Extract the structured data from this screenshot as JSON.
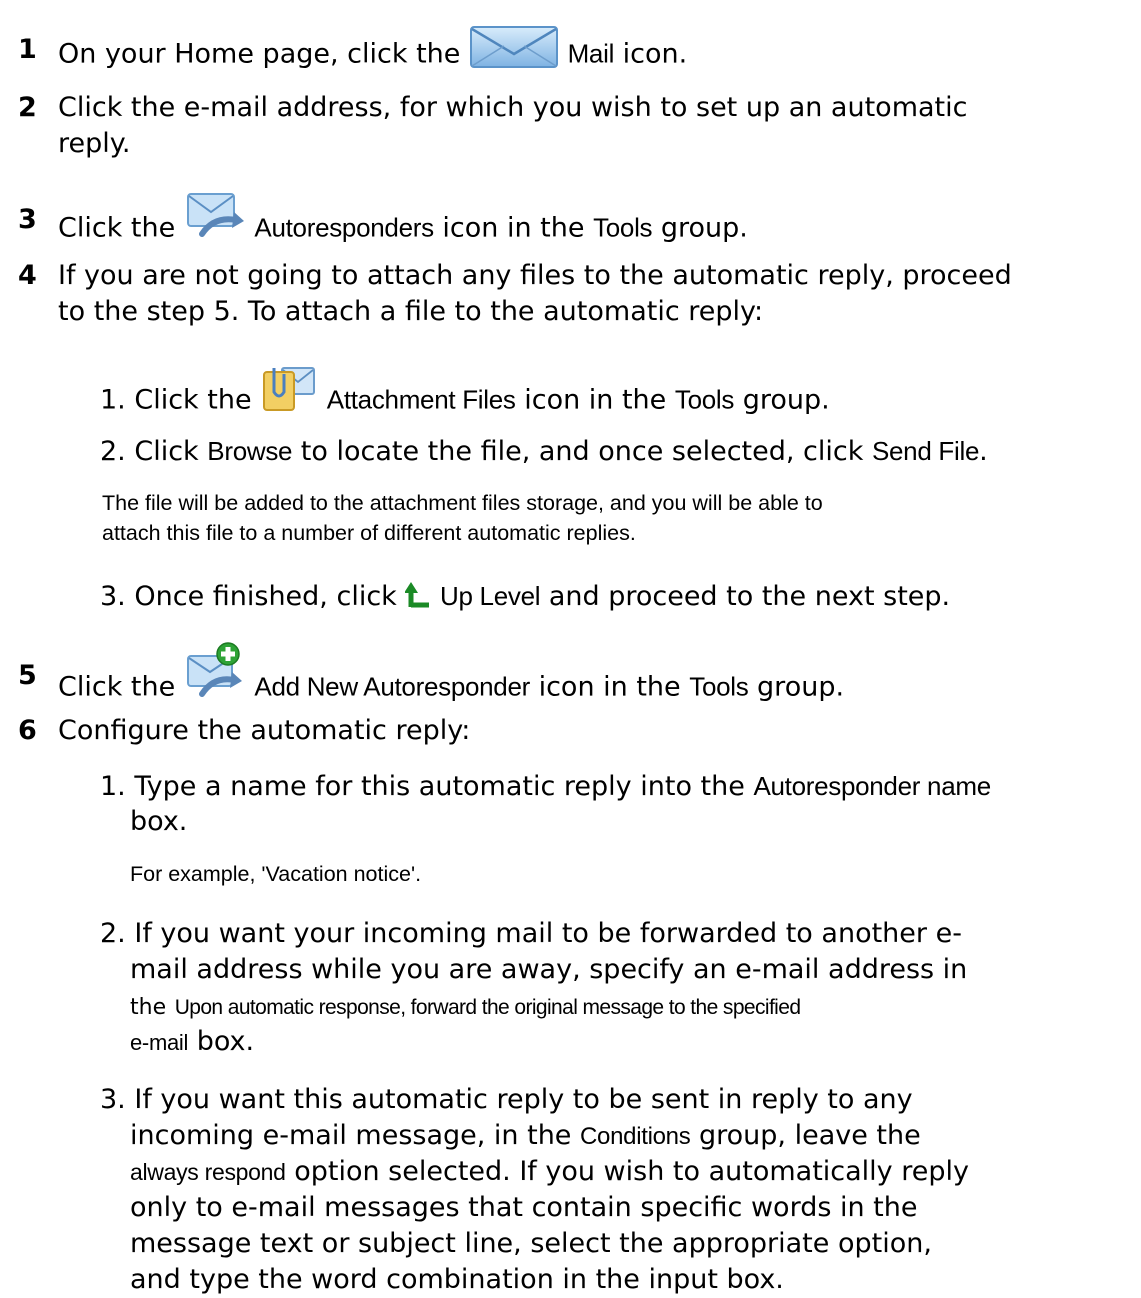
{
  "steps": [
    {
      "num": "1",
      "pre": "On your Home page, click the",
      "ui": "Mail",
      "post": "icon.",
      "icon": "mail-icon"
    },
    {
      "num": "2",
      "line1": "Click the e-mail address, for which you wish to set up an automatic",
      "line2": "reply."
    },
    {
      "num": "3",
      "pre": "Click the",
      "ui": "Autoresponders",
      "post": "icon in the",
      "ui2": "Tools",
      "post2": "group.",
      "icon": "autoresponders-icon"
    },
    {
      "num": "4",
      "line1": "If you are not going to attach any files to the automatic reply, proceed",
      "line2": "to the step 5. To attach a file to the automatic reply:",
      "substeps": [
        {
          "num": "1.",
          "pre": "Click the",
          "ui": "Attachment Files",
          "post": "icon in the",
          "ui2": "Tools",
          "post2": "group.",
          "icon": "attachment-files-icon"
        },
        {
          "num": "2.",
          "pre": "Click",
          "ui": "Browse",
          "post": "to locate the file, and once selected, click",
          "ui2": "Send File",
          "post2": "."
        },
        {
          "num": "3.",
          "pre": "Once finished, click",
          "ui": "Up Level",
          "post": "and proceed to the next step.",
          "icon": "up-level-icon"
        }
      ],
      "note": {
        "line1": "The file will be added to the attachment files storage, and you will be able to",
        "line2": "attach this file to a number of different automatic replies."
      }
    },
    {
      "num": "5",
      "pre": "Click the",
      "ui": "Add New Autoresponder",
      "post": "icon in the",
      "ui2": "Tools",
      "post2": "group.",
      "icon": "add-autoresponder-icon"
    },
    {
      "num": "6",
      "text": "Configure the automatic reply:",
      "substeps": [
        {
          "num": "1.",
          "pre": "Type a name for this automatic reply into the",
          "ui": "Autoresponder name",
          "line2": "box."
        },
        {
          "num": "2.",
          "line1": "If you want your incoming mail to be forwarded to another e-",
          "line2": "mail address while you are away, specify an e-mail address in",
          "l3pre": "the",
          "ui": "Upon automatic response, forward the original message to the specified",
          "l4ui": "e-mail",
          "l4post": "box."
        },
        {
          "num": "3.",
          "line1": "If you want this automatic reply to be sent in reply to any",
          "l2pre": "incoming e-mail message, in the",
          "ui": "Conditions",
          "l2post": "group, leave the",
          "l3ui": "always respond",
          "l3post": "option selected. If you wish to automatically reply",
          "line4": "only to e-mail messages that contain specific words in the",
          "line5": "message text or subject line, select the appropriate option,",
          "line6": "and type the word combination in the input box."
        }
      ],
      "note": "For example, 'Vacation notice'."
    }
  ]
}
